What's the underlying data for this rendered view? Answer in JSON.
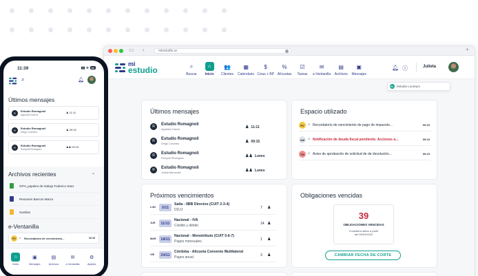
{
  "browser": {
    "url": "miestudio.ar"
  },
  "brand": {
    "logo_line1": "mi",
    "logo_line2": "estudio",
    "accent": "#0f9f8e",
    "navy": "#2e3a8c",
    "alert": "#c6283d"
  },
  "nav": {
    "items": [
      {
        "label": "Buscar",
        "icon": "search-icon",
        "glyph": "⌕"
      },
      {
        "label": "Inicio",
        "icon": "home-icon",
        "glyph": "⌂",
        "active": true
      },
      {
        "label": "Clientes",
        "icon": "clients-icon",
        "glyph": "👥"
      },
      {
        "label": "Calendario",
        "icon": "calendar-icon",
        "glyph": "▦"
      },
      {
        "label": "Ccias + BP",
        "icon": "money-icon",
        "glyph": "$"
      },
      {
        "label": "Alícuotas",
        "icon": "percent-icon",
        "glyph": "%"
      },
      {
        "label": "Tareas",
        "icon": "tasks-icon",
        "glyph": "☑"
      },
      {
        "label": "e-Ventanilla",
        "icon": "mail-icon",
        "glyph": "✉"
      },
      {
        "label": "Archivos",
        "icon": "files-icon",
        "glyph": "▤"
      },
      {
        "label": "Mensajes",
        "icon": "messages-icon",
        "glyph": "▣"
      }
    ],
    "user_name": "Julieta",
    "studio_popover": "Estudio Loureyro",
    "studio_badge": "EL"
  },
  "ultimos_mensajes": {
    "title": "Últimos mensajes",
    "items": [
      {
        "name": "Estudio Romagnoli",
        "sub": "Agustina García",
        "meta": "11:11",
        "avatar": "R"
      },
      {
        "name": "Estudio Romagnoli",
        "sub": "Diego Colombo",
        "meta": "09:15",
        "avatar": "R"
      },
      {
        "name": "Estudio Romagnoli",
        "sub": "Ezequiel Rodriguez",
        "meta": "Lunes",
        "avatar": "R"
      },
      {
        "name": "Estudio Romagnoli",
        "sub": "Julieta Mercedes",
        "meta": "Lunes",
        "avatar": "R"
      }
    ]
  },
  "espacio_utilizado": {
    "title": "Espacio utilizado",
    "items": [
      {
        "badge": "PV",
        "color": "#f5c542",
        "text": "Recordatorio de vencimiento de pago de impuesto...",
        "time": "09:15",
        "alert": false
      },
      {
        "badge": "AM",
        "color": "#e0e3e8",
        "text": "Notificación de deuda fiscal pendiente. Acciones a...",
        "time": "09:15",
        "alert": true
      },
      {
        "badge": "TH",
        "color": "#f08a8a",
        "text": "Aviso de aprobación de solicitud de  de devolución...",
        "time": "09:15",
        "alert": false
      }
    ]
  },
  "proximos_vencimientos": {
    "title": "Próximos vencimientos",
    "items": [
      {
        "day": "LUN",
        "date": "3/11",
        "title": "Salta - IIBB Directos (CUIT 2-3-4)",
        "sub": "DDJJ",
        "count": "7"
      },
      {
        "day": "JUE",
        "date": "11/11",
        "title": "Nacional - IVA",
        "sub": "Crédito y débito",
        "count": "14"
      },
      {
        "day": "MAR",
        "date": "18/11",
        "title": "Nacional - Monotributo (CUIT 5-6-7)",
        "sub": "Pagos mensuales",
        "count": "1"
      },
      {
        "day": "VIE",
        "date": "24/11",
        "title": "Córdoba - Alícuota Convenio Multilateral",
        "sub": "Pagos anual",
        "count": "3"
      }
    ]
  },
  "obligaciones": {
    "title": "Obligaciones vencidas",
    "count": "39",
    "label": "OBLIGACIONES VENCIDAS",
    "sub_line1": "Considera datos a partir",
    "sub_line2": "del 05/04/2022",
    "button": "CAMBIAR FECHA DE CORTE"
  },
  "phone": {
    "time": "11:39",
    "battery": "82",
    "msgs_title": "Últimos mensajes",
    "msgs": [
      {
        "name": "Estudio Romagnoli",
        "sub": "Agustina García",
        "meta": "11:11"
      },
      {
        "name": "Estudio Romagnoli",
        "sub": "Diego Colombo",
        "meta": "09:15"
      },
      {
        "name": "Estudio Romagnoli",
        "sub": "Ezequiel Rodriguez",
        "meta": "09:15"
      }
    ],
    "archivos_title": "Archivos recientes",
    "archivos": [
      {
        "name": "GPH_papeles de trabajo Federico Sanz",
        "color": "#2f9e44"
      },
      {
        "name": "Resumen Bancos Marzo",
        "color": "#2e3a8c"
      },
      {
        "name": "Sueldos",
        "color": "#f2b632"
      }
    ],
    "ventanilla_title": "e-Ventanilla",
    "ventanilla_item": {
      "badge": "PV",
      "text": "Recordatorio de vencimiento...",
      "time": "09:15"
    },
    "tabs": [
      {
        "label": "Inicio",
        "glyph": "⌂",
        "icon": "home-icon",
        "active": true
      },
      {
        "label": "Mensajes",
        "glyph": "▣",
        "icon": "messages-icon"
      },
      {
        "label": "Archivos",
        "glyph": "▤",
        "icon": "files-icon"
      },
      {
        "label": "e-Ventanilla",
        "glyph": "✉",
        "icon": "mail-icon"
      },
      {
        "label": "Ajustes",
        "glyph": "⚙",
        "icon": "gear-icon"
      }
    ]
  }
}
